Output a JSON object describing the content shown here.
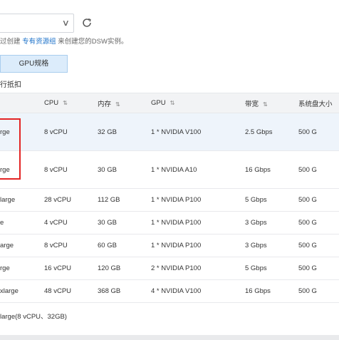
{
  "refresh_icon": "refresh-icon",
  "hint": {
    "prefix": "过创建 ",
    "link": "专有资源组",
    "suffix": " 来创建您的DSW实例。"
  },
  "tab_gpu": "GPU规格",
  "sub_label": "行抵扣",
  "table": {
    "headers": {
      "cpu": "CPU",
      "mem": "内存",
      "gpu": "GPU",
      "bw": "带宽",
      "disk": "系统盘大小"
    },
    "sort_icon": "⇅",
    "rows": [
      {
        "name": "rge",
        "cpu": "8 vCPU",
        "mem": "32 GB",
        "gpu": "1 * NVIDIA V100",
        "bw": "2.5 Gbps",
        "disk": "500 G"
      },
      {
        "name": "rge",
        "cpu": "8 vCPU",
        "mem": "30 GB",
        "gpu": "1 * NVIDIA A10",
        "bw": "16 Gbps",
        "disk": "500 G"
      },
      {
        "name": "large",
        "cpu": "28 vCPU",
        "mem": "112 GB",
        "gpu": "1 * NVIDIA P100",
        "bw": "5 Gbps",
        "disk": "500 G"
      },
      {
        "name": "e",
        "cpu": "4 vCPU",
        "mem": "30 GB",
        "gpu": "1 * NVIDIA P100",
        "bw": "3 Gbps",
        "disk": "500 G"
      },
      {
        "name": "arge",
        "cpu": "8 vCPU",
        "mem": "60 GB",
        "gpu": "1 * NVIDIA P100",
        "bw": "3 Gbps",
        "disk": "500 G"
      },
      {
        "name": "rge",
        "cpu": "16 vCPU",
        "mem": "120 GB",
        "gpu": "2 * NVIDIA P100",
        "bw": "5 Gbps",
        "disk": "500 G"
      },
      {
        "name": "xlarge",
        "cpu": "48 vCPU",
        "mem": "368 GB",
        "gpu": "4 * NVIDIA V100",
        "bw": "16 Gbps",
        "disk": "500 G"
      }
    ]
  },
  "footer": "large(8 vCPU、32GB)"
}
